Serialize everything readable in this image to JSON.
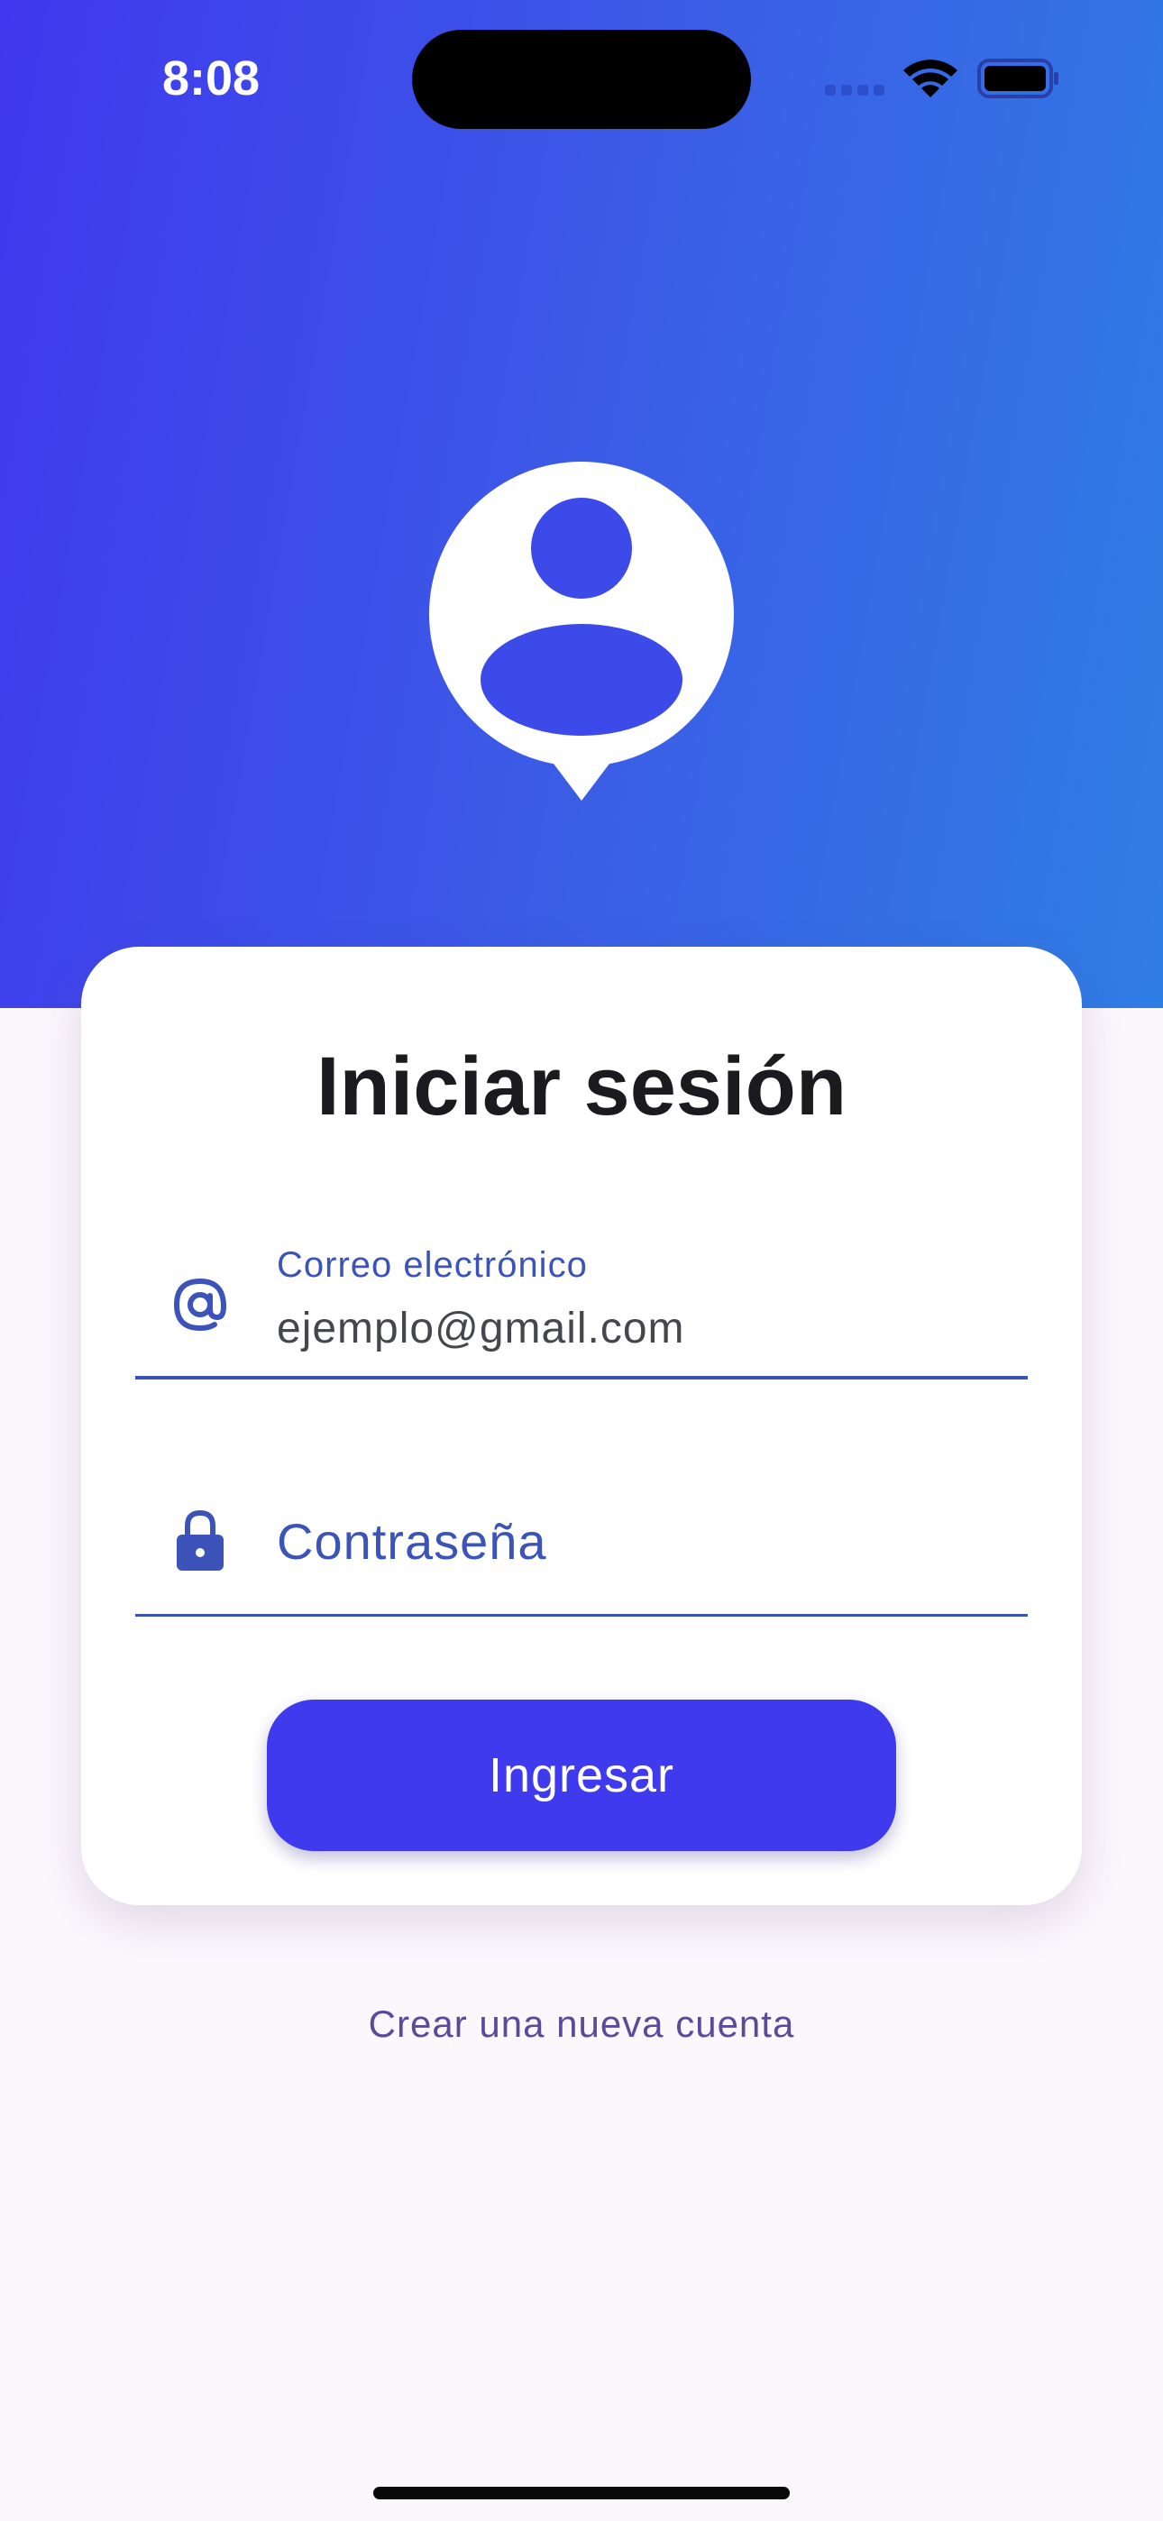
{
  "status_bar": {
    "time": "8:08"
  },
  "login": {
    "title": "Iniciar sesión",
    "email_field": {
      "label": "Correo electrónico",
      "value": "ejemplo@gmail.com"
    },
    "password_field": {
      "placeholder": "Contraseña"
    },
    "submit_label": "Ingresar",
    "create_account_label": "Crear una nueva cuenta"
  },
  "icons": {
    "hero": "user-location-pin-icon",
    "email": "at-sign-icon",
    "password": "lock-icon"
  },
  "colors": {
    "gradient_start": "#4038ee",
    "gradient_end": "#2f7ee4",
    "primary": "#3f3aee",
    "field_accent": "#3c54b9",
    "background": "#fcf6fd"
  }
}
